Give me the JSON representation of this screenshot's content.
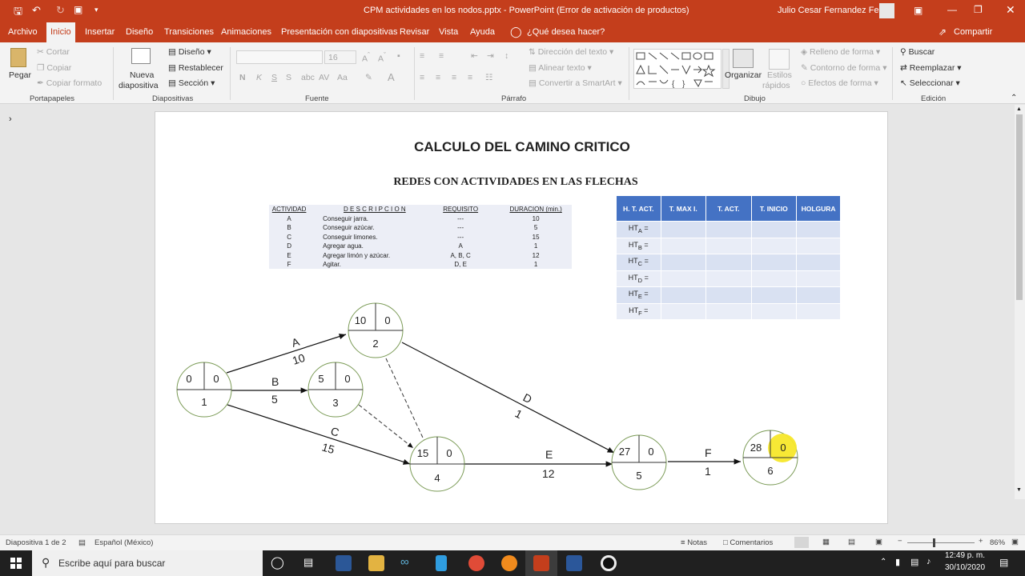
{
  "titlebar": {
    "title": "CPM actividades en los nodos.pptx  -  PowerPoint (Error de activación de productos)",
    "user": "Julio Cesar Fernandez Felix"
  },
  "menu": {
    "tabs": [
      "Archivo",
      "Inicio",
      "Insertar",
      "Diseño",
      "Transiciones",
      "Animaciones",
      "Presentación con diapositivas",
      "Revisar",
      "Vista",
      "Ayuda"
    ],
    "active": "Inicio",
    "tellme": "¿Qué desea hacer?",
    "share": "Compartir"
  },
  "ribbon": {
    "portapapeles": {
      "paste": "Pegar",
      "cut": "Cortar",
      "copy": "Copiar",
      "format": "Copiar formato",
      "label": "Portapapeles"
    },
    "diapositivas": {
      "new": "Nueva",
      "new2": "diapositiva",
      "layout": "Diseño",
      "reset": "Restablecer",
      "section": "Sección",
      "label": "Diapositivas"
    },
    "fuente": {
      "size": "16",
      "label": "Fuente",
      "bold": "N",
      "italic": "K",
      "underline": "S",
      "strike": "S"
    },
    "parrafo": {
      "dir": "Dirección del texto",
      "align": "Alinear texto",
      "smartart": "Convertir a SmartArt",
      "label": "Párrafo"
    },
    "dibujo": {
      "arrange": "Organizar",
      "styles": "Estilos",
      "styles2": "rápidos",
      "fill": "Relleno de forma",
      "outline": "Contorno de forma",
      "effects": "Efectos de forma",
      "label": "Dibujo"
    },
    "edicion": {
      "find": "Buscar",
      "replace": "Reemplazar",
      "select": "Seleccionar",
      "label": "Edición"
    }
  },
  "slide": {
    "title": "CALCULO DEL CAMINO CRITICO",
    "subtitle": "REDES CON ACTIVIDADES EN LAS FLECHAS",
    "activity_table": {
      "headers": [
        "ACTIVIDAD",
        "D E S C R I P C I O N",
        "REQUISITO",
        "DURACION (min.)"
      ],
      "rows": [
        [
          "A",
          "Conseguir jarra.",
          "---",
          "10"
        ],
        [
          "B",
          "Conseguir azúcar.",
          "---",
          "5"
        ],
        [
          "C",
          "Conseguir limones.",
          "---",
          "15"
        ],
        [
          "D",
          "Agregar agua.",
          "A",
          "1"
        ],
        [
          "E",
          "Agregar limón y azúcar.",
          "A, B, C",
          "12"
        ],
        [
          "F",
          "Agitar.",
          "D, E",
          "1"
        ]
      ]
    },
    "ht_table": {
      "headers": [
        "H. T. ACT.",
        "T. MAX I.",
        "T. ACT.",
        "T. INICIO",
        "HOLGURA"
      ],
      "rows": [
        {
          "base": "HT",
          "sub": "A",
          "eq": " ="
        },
        {
          "base": "HT",
          "sub": "B",
          "eq": " ="
        },
        {
          "base": "HT",
          "sub": "C",
          "eq": " ="
        },
        {
          "base": "HT",
          "sub": "D",
          "eq": " ="
        },
        {
          "base": "HT",
          "sub": "E",
          "eq": " ="
        },
        {
          "base": "HT",
          "sub": "F",
          "eq": " ="
        }
      ]
    },
    "nodes": [
      {
        "id": "1",
        "a": "0",
        "b": "0"
      },
      {
        "id": "2",
        "a": "10",
        "b": "0"
      },
      {
        "id": "3",
        "a": "5",
        "b": "0"
      },
      {
        "id": "4",
        "a": "15",
        "b": "0"
      },
      {
        "id": "5",
        "a": "27",
        "b": "0"
      },
      {
        "id": "6",
        "a": "28",
        "b": "0"
      }
    ],
    "arrows": [
      {
        "act": "A",
        "dur": "10"
      },
      {
        "act": "B",
        "dur": "5"
      },
      {
        "act": "C",
        "dur": "15"
      },
      {
        "act": "D",
        "dur": "1"
      },
      {
        "act": "E",
        "dur": "12"
      },
      {
        "act": "F",
        "dur": "1"
      }
    ]
  },
  "status": {
    "slide": "Diapositiva 1 de 2",
    "lang": "Español (México)",
    "notes": "Notas",
    "comments": "Comentarios",
    "zoom": "86%"
  },
  "taskbar": {
    "search": "Escribe aquí para buscar",
    "time": "12:49 p. m.",
    "date": "30/10/2020"
  }
}
